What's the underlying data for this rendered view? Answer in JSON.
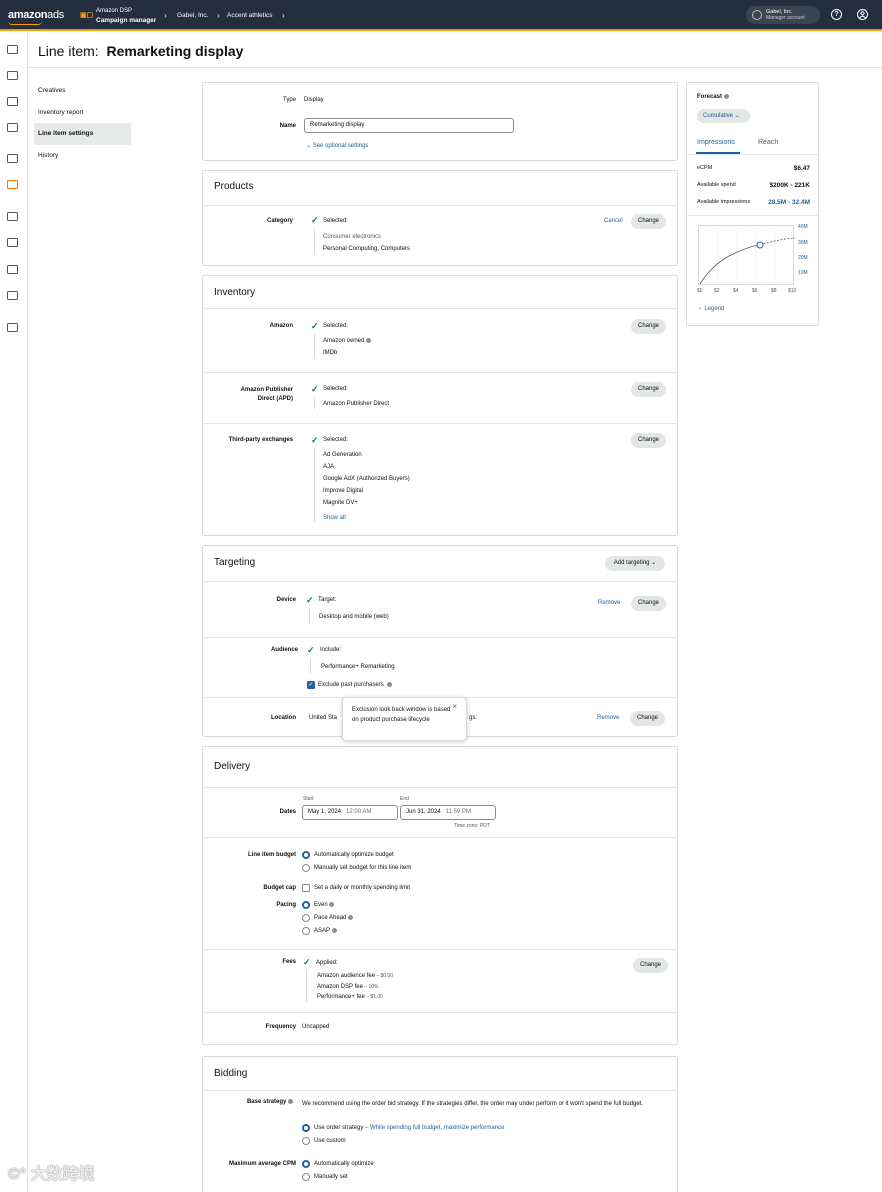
{
  "topbar": {
    "logo_main": "amazon",
    "logo_ads": "ads",
    "product_line1": "Amazon DSP",
    "product_line2": "Campaign manager",
    "crumbs": [
      "Gabel, Inc.",
      "Accent athletics"
    ],
    "account_name": "Gabel, Inc.",
    "account_role": "Manager account",
    "help_icon": "?",
    "user_icon": "user"
  },
  "page": {
    "title_prefix": "Line item:",
    "title_name": "Remarketing display"
  },
  "subnav": [
    "Creatives",
    "Inventory report",
    "Line item settings",
    "History"
  ],
  "basics": {
    "type_label": "Type",
    "type_value": "Display",
    "name_label": "Name",
    "name_value": "Remarketing display",
    "optional_link": "See optional settings"
  },
  "products": {
    "title": "Products",
    "category_label": "Category",
    "selected": "Selected:",
    "category_parent": "Consumer electronics",
    "category_child": "Personal Computing, Computers",
    "cancel": "Cancel",
    "change": "Change"
  },
  "inventory": {
    "title": "Inventory",
    "amazon_label": "Amazon",
    "amazon_selected": "Selected:",
    "amazon_items": [
      "Amazon owned",
      "IMDb"
    ],
    "apd_label_1": "Amazon Publisher",
    "apd_label_2": "Direct (APD)",
    "apd_selected": "Selected:",
    "apd_items": [
      "Amazon Publisher Direct"
    ],
    "tpe_label": "Third-party exchanges",
    "tpe_selected": "Selected:",
    "tpe_items": [
      "Ad Generation",
      "AJA",
      "Google AdX (Authorized Buyers)",
      "Improve Digital",
      "Magnite DV+"
    ],
    "show_all": "Show all",
    "change": "Change"
  },
  "targeting": {
    "title": "Targeting",
    "add_targeting": "Add targeting",
    "device_label": "Device",
    "device_status": "Target:",
    "device_value": "Desktop and mobile (web)",
    "audience_label": "Audience",
    "audience_status": "Include:",
    "audience_value": "Performance+ Remarketing",
    "exclude_label": "Exclude past purchasers",
    "location_label": "Location",
    "location_value": "United Sta",
    "location_suffix": "gs:",
    "remove": "Remove",
    "change": "Change",
    "tooltip": "Exclusion look back window is based on product purchase lifecycle"
  },
  "delivery": {
    "title": "Delivery",
    "dates_label": "Dates",
    "start_label": "Start",
    "start_date": "May 1, 2024",
    "start_time": "12:00 AM",
    "end_label": "End",
    "end_date": "Jun 31, 2024",
    "end_time": "11:59 PM",
    "timezone": "Time zone: PDT",
    "budget_label": "Line item budget",
    "budget_opt1": "Automatically optimize budget",
    "budget_opt2": "Manually set budget for this line item",
    "cap_label": "Budget cap",
    "cap_opt": "Set a daily or monthly spending limit",
    "pacing_label": "Pacing",
    "pacing_opts": [
      "Even",
      "Pace Ahead",
      "ASAP"
    ],
    "fees_label": "Fees",
    "fees_status": "Applied:",
    "fees": [
      {
        "name": "Amazon audience fee",
        "value": " – $0.00"
      },
      {
        "name": "Amazon DSP fee",
        "value": " – 10%"
      },
      {
        "name": "Performance+ fee",
        "value": " – $1.00"
      }
    ],
    "fees_change": "Change",
    "freq_label": "Frequency",
    "freq_value": "Uncapped"
  },
  "bidding": {
    "title": "Bidding",
    "base_label": "Base strategy",
    "base_text": "We recommend using the order bid strategy. If the strategies differ, the order may under perform or it won't spend the full budget.",
    "opt1": "Use order strategy",
    "opt1_note": " – While spending full budget, maximize performance",
    "opt2": "Use custom",
    "cpm_label": "Maximum average CPM",
    "cpm_opt1": "Automatically optimize",
    "cpm_opt2": "Manually set"
  },
  "forecast": {
    "title": "Forecast",
    "mode": "Cumulative",
    "tab_active": "Impressions",
    "tab_other": "Reach",
    "ecpm_label": "eCPM",
    "ecpm_value": "$6.47",
    "spend_label": "Available spend",
    "spend_value": "$200K - 221K",
    "impr_label": "Available impressions",
    "impr_value": "28.5M - 32.4M",
    "y_ticks": [
      "40M",
      "30M",
      "20M",
      "10M"
    ],
    "x_ticks": [
      "$0",
      "$2",
      "$4",
      "$6",
      "$8",
      "$10"
    ],
    "legend": "Legend",
    "accent": "#2162a1"
  },
  "watermark": "大数跨境"
}
